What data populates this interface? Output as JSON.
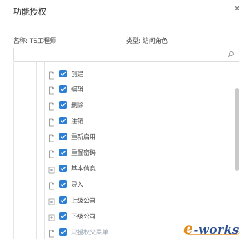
{
  "dialog": {
    "title": "功能授权",
    "close_glyph": "×"
  },
  "meta": {
    "name_text": "名称: TS工程师",
    "type_text": "类型: 访问角色"
  },
  "search": {
    "value": "",
    "placeholder": ""
  },
  "tree": {
    "items": [
      {
        "label": "创建",
        "icon": "file-icon",
        "checked": true
      },
      {
        "label": "编辑",
        "icon": "file-icon",
        "checked": true
      },
      {
        "label": "删除",
        "icon": "file-icon",
        "checked": true
      },
      {
        "label": "注销",
        "icon": "file-icon",
        "checked": true
      },
      {
        "label": "重新启用",
        "icon": "file-icon",
        "checked": true
      },
      {
        "label": "重置密码",
        "icon": "file-icon",
        "checked": true
      },
      {
        "label": "基本信息",
        "icon": "expand-plus-icon",
        "checked": true
      },
      {
        "label": "导入",
        "icon": "file-icon",
        "checked": true
      },
      {
        "label": "上级公司",
        "icon": "expand-plus-icon",
        "checked": true
      },
      {
        "label": "下级公司",
        "icon": "expand-plus-icon",
        "checked": true
      },
      {
        "label": "只授权父菜单",
        "icon": "file-icon",
        "checked": true,
        "faded": true
      }
    ]
  },
  "watermark": {
    "text": "e-works"
  }
}
